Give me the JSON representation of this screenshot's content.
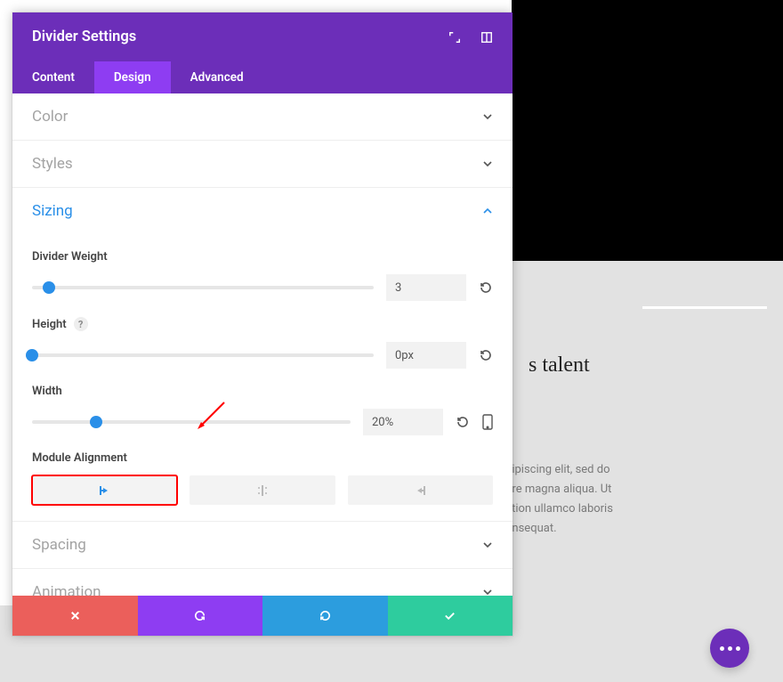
{
  "panel": {
    "title": "Divider Settings"
  },
  "tabs": {
    "content": "Content",
    "design": "Design",
    "advanced": "Advanced",
    "active": "design"
  },
  "sections": {
    "color": "Color",
    "styles": "Styles",
    "sizing": "Sizing",
    "spacing": "Spacing",
    "animation": "Animation"
  },
  "sizing": {
    "divider_weight": {
      "label": "Divider Weight",
      "value": "3",
      "thumb_pct": 5
    },
    "height": {
      "label": "Height",
      "help": "?",
      "value": "0px",
      "thumb_pct": 0
    },
    "width": {
      "label": "Width",
      "value": "20%",
      "thumb_pct": 20
    },
    "module_alignment": {
      "label": "Module Alignment",
      "selected": "left"
    }
  },
  "preview": {
    "title_fragment": "s talent",
    "body_line1": "dipiscing elit, sed do",
    "body_line2": "ore magna aliqua. Ut",
    "body_line3": "ation ullamco laboris",
    "body_line4": "onsequat."
  },
  "icons": {
    "expand": "expand-icon",
    "help": "help-icon",
    "chev_down": "chevron-down-icon",
    "chev_up": "chevron-up-icon",
    "reset": "reset-icon",
    "device": "device-icon",
    "align_left": "align-left-icon",
    "align_center": "align-center-icon",
    "align_right": "align-right-icon",
    "close": "close-icon",
    "undo": "undo-icon",
    "redo": "redo-icon",
    "check": "check-icon",
    "more": "more-icon"
  }
}
